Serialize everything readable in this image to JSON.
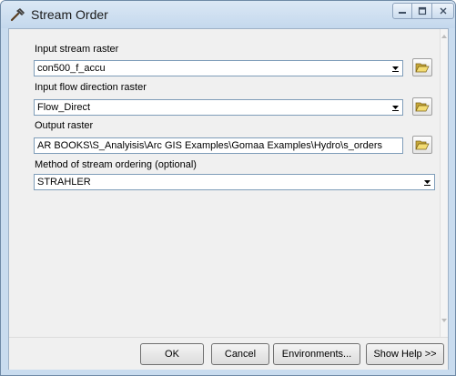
{
  "window": {
    "title": "Stream Order",
    "icon": "hammer-icon",
    "controls": [
      "minimize-icon",
      "maximize-icon",
      "close-icon"
    ]
  },
  "form": {
    "input_stream": {
      "label": "Input stream raster",
      "value": "con500_f_accu"
    },
    "input_flowdir": {
      "label": "Input flow direction raster",
      "value": "Flow_Direct"
    },
    "output_raster": {
      "label": "Output raster",
      "value": "AR BOOKS\\S_Analyisis\\Arc GIS Examples\\Gomaa Examples\\Hydro\\s_orders"
    },
    "method": {
      "label": "Method of stream ordering (optional)",
      "value": "STRAHLER"
    }
  },
  "buttons": {
    "ok": "OK",
    "cancel": "Cancel",
    "environments": "Environments...",
    "show_help": "Show Help >>"
  },
  "colors": {
    "frame": "#c9dcef",
    "client": "#f0f0f0",
    "field_border": "#7f9db9"
  }
}
